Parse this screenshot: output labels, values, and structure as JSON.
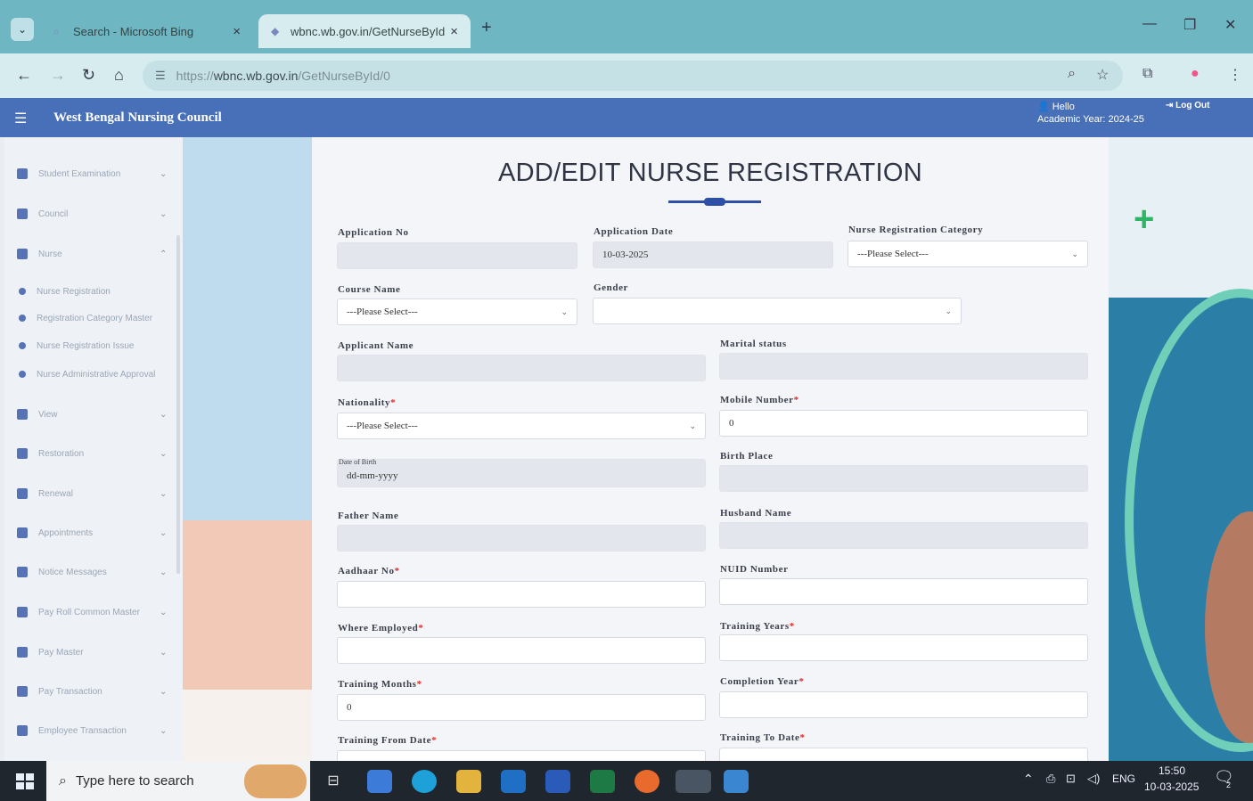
{
  "browser": {
    "tabs": [
      {
        "label": "Search - Microsoft Bing",
        "active": false
      },
      {
        "label": "wbnc.wb.gov.in/GetNurseById",
        "active": true
      }
    ],
    "url_prefix": "https://",
    "url_host": "wbnc.wb.gov.in",
    "url_path": "/GetNurseById/0"
  },
  "header": {
    "app_title": "West Bengal Nursing Council",
    "hello": "Hello",
    "academic_year": "Academic Year: 2024-25",
    "logout": "Log Out"
  },
  "sidebar": {
    "items": [
      {
        "label": "Student Examination",
        "chevron": "v"
      },
      {
        "label": "Council",
        "chevron": "v"
      },
      {
        "label": "Nurse",
        "chevron": "^"
      },
      {
        "label": "View",
        "chevron": "v"
      },
      {
        "label": "Restoration",
        "chevron": "v"
      },
      {
        "label": "Renewal",
        "chevron": "v"
      },
      {
        "label": "Appointments",
        "chevron": "v"
      },
      {
        "label": "Notice Messages",
        "chevron": "v"
      },
      {
        "label": "Pay Roll Common Master",
        "chevron": "v"
      },
      {
        "label": "Pay Master",
        "chevron": "v"
      },
      {
        "label": "Pay Transaction",
        "chevron": "v"
      },
      {
        "label": "Employee Transaction",
        "chevron": "v"
      }
    ],
    "nurse_subitems": [
      "Nurse Registration",
      "Registration Category Master",
      "Nurse Registration Issue",
      "Nurse Administrative Approval"
    ]
  },
  "form": {
    "title": "ADD/EDIT NURSE REGISTRATION",
    "application_no": {
      "label": "Application No",
      "value": ""
    },
    "application_date": {
      "label": "Application Date",
      "value": "10-03-2025"
    },
    "reg_category": {
      "label": "Nurse Registration Category",
      "value": "---Please Select---"
    },
    "course_name": {
      "label": "Course Name",
      "value": "---Please Select---"
    },
    "gender": {
      "label": "Gender",
      "value": ""
    },
    "applicant_name": {
      "label": "Applicant Name",
      "value": ""
    },
    "marital_status": {
      "label": "Marital status",
      "value": ""
    },
    "nationality": {
      "label": "Nationality",
      "value": "---Please Select---"
    },
    "mobile_number": {
      "label": "Mobile Number",
      "value": "0"
    },
    "dob": {
      "label": "Date of Birth",
      "value": "dd-mm-yyyy"
    },
    "birth_place": {
      "label": "Birth Place",
      "value": ""
    },
    "father_name": {
      "label": "Father Name",
      "value": ""
    },
    "husband_name": {
      "label": "Husband Name",
      "value": ""
    },
    "aadhaar_no": {
      "label": "Aadhaar No",
      "value": ""
    },
    "nuid_number": {
      "label": "NUID Number",
      "value": ""
    },
    "where_employed": {
      "label": "Where Employed",
      "value": ""
    },
    "training_years": {
      "label": "Training Years",
      "value": ""
    },
    "training_months": {
      "label": "Training Months",
      "value": "0"
    },
    "completion_year": {
      "label": "Completion Year",
      "value": ""
    },
    "training_from": {
      "label": "Training From Date"
    },
    "training_to": {
      "label": "Training To Date"
    },
    "required_mark": "*"
  },
  "taskbar": {
    "search_placeholder": "Type here to search",
    "lang": "ENG",
    "time": "15:50",
    "date": "10-03-2025",
    "notification_count": "2"
  },
  "colors": {
    "header_blue": "#4770b8",
    "tab_teal": "#6fb6c3",
    "required_red": "#e02a2a",
    "plus_green": "#2fb366"
  }
}
